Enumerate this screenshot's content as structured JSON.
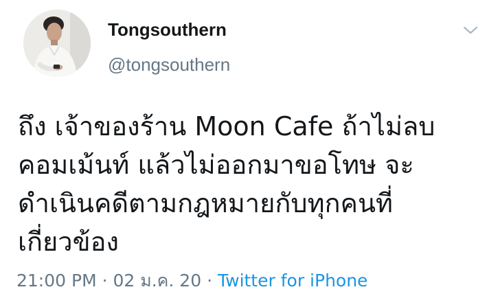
{
  "tweet": {
    "display_name": "Tongsouthern",
    "handle": "@tongsouthern",
    "avatar_icon": "profile-photo",
    "menu_icon": "chevron-down-icon",
    "text_lines": [
      "ถึง เจ้าของร้าน Moon Cafe ถ้าไม่ลบ",
      "คอมเม้นท์ แล้วไม่ออกมาขอโทษ จะ",
      "ดำเนินคดีตามกฎหมายกับทุกคนที่",
      "เกี่ยวข้อง"
    ],
    "time": "21:00 PM",
    "separator": "·",
    "date": "02 ม.ค. 20",
    "source": "Twitter for iPhone"
  },
  "colors": {
    "text": "#14171a",
    "secondary": "#657786",
    "link": "#1b95e0",
    "background": "#ffffff"
  }
}
